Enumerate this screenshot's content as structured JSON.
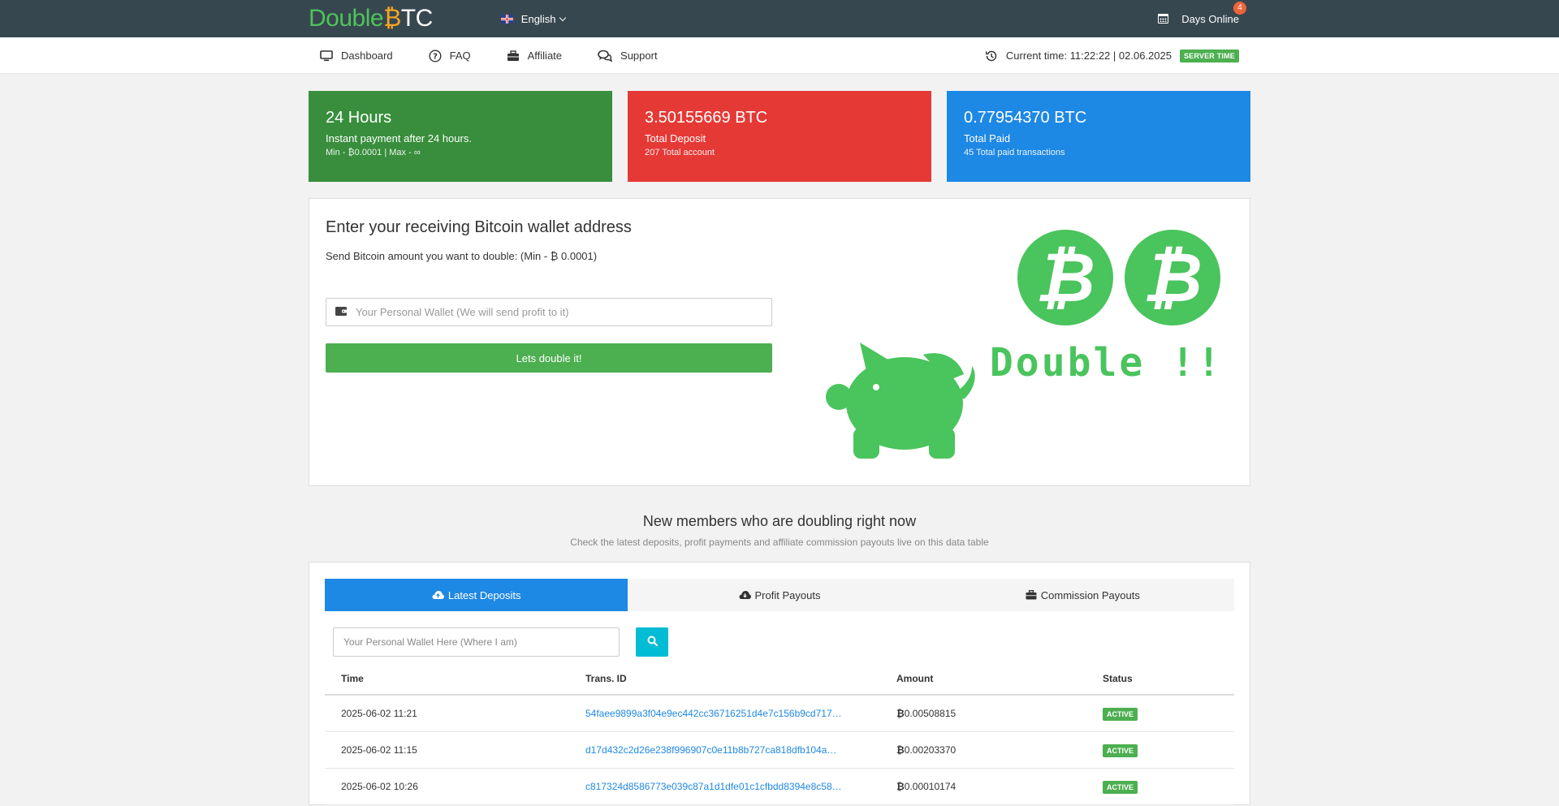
{
  "header": {
    "logo": {
      "part1": "Double",
      "part2": "₿",
      "part3": "TC"
    },
    "language": "English",
    "days_online_label": "Days Online",
    "days_online_count": "4"
  },
  "nav": {
    "items": [
      {
        "label": "Dashboard",
        "icon": "monitor-icon"
      },
      {
        "label": "FAQ",
        "icon": "question-circle-icon"
      },
      {
        "label": "Affiliate",
        "icon": "briefcase-icon"
      },
      {
        "label": "Support",
        "icon": "chat-icon"
      }
    ],
    "current_time": "Current time: 11:22:22 | 02.06.2025",
    "server_time_badge": "SERVER TIME"
  },
  "cards": [
    {
      "title": "24 Hours",
      "subtitle": "Instant payment after 24 hours.",
      "small": "Min - ₿0.0001 | Max - ∞",
      "color": "#388e3c"
    },
    {
      "title": "3.50155669 BTC",
      "subtitle": "Total Deposit",
      "small": "207 Total account",
      "color": "#e53935"
    },
    {
      "title": "0.77954370 BTC",
      "subtitle": "Total Paid",
      "small": "45 Total paid transactions",
      "color": "#1e88e5"
    }
  ],
  "wallet_panel": {
    "title": "Enter your receiving Bitcoin wallet address",
    "subtitle": "Send Bitcoin amount you want to double: (Min - ₿ 0.0001)",
    "placeholder": "Your Personal Wallet (We will send profit to it)",
    "button": "Lets double it!",
    "coin_symbol": "₿",
    "double_text": "Double !!",
    "accent": "#4ac45c"
  },
  "section": {
    "title": "New members who are doubling right now",
    "subtitle": "Check the latest deposits, profit payments and affiliate commission payouts live on this data table"
  },
  "table_panel": {
    "tabs": [
      {
        "label": "Latest Deposits",
        "icon": "cloud-upload-icon",
        "active": true
      },
      {
        "label": "Profit Payouts",
        "icon": "cloud-download-icon",
        "active": false
      },
      {
        "label": "Commission Payouts",
        "icon": "briefcase-icon",
        "active": false
      }
    ],
    "search_placeholder": "Your Personal Wallet Here (Where I am)",
    "columns": [
      "Time",
      "Trans. ID",
      "Amount",
      "Status"
    ],
    "rows": [
      {
        "time": "2025-06-02 11:21",
        "txid": "54faee9899a3f04e9ec442cc36716251d4e7c156b9cd717…",
        "amount": "0.00508815",
        "status": "ACTIVE"
      },
      {
        "time": "2025-06-02 11:15",
        "txid": "d17d432c2d26e238f996907c0e11b8b727ca818dfb104a…",
        "amount": "0.00203370",
        "status": "ACTIVE"
      },
      {
        "time": "2025-06-02 10:26",
        "txid": "c817324d8586773e039c87a1d1dfe01c1cfbdd8394e8c58…",
        "amount": "0.00010174",
        "status": "ACTIVE"
      }
    ],
    "currency_symbol": "₿"
  }
}
